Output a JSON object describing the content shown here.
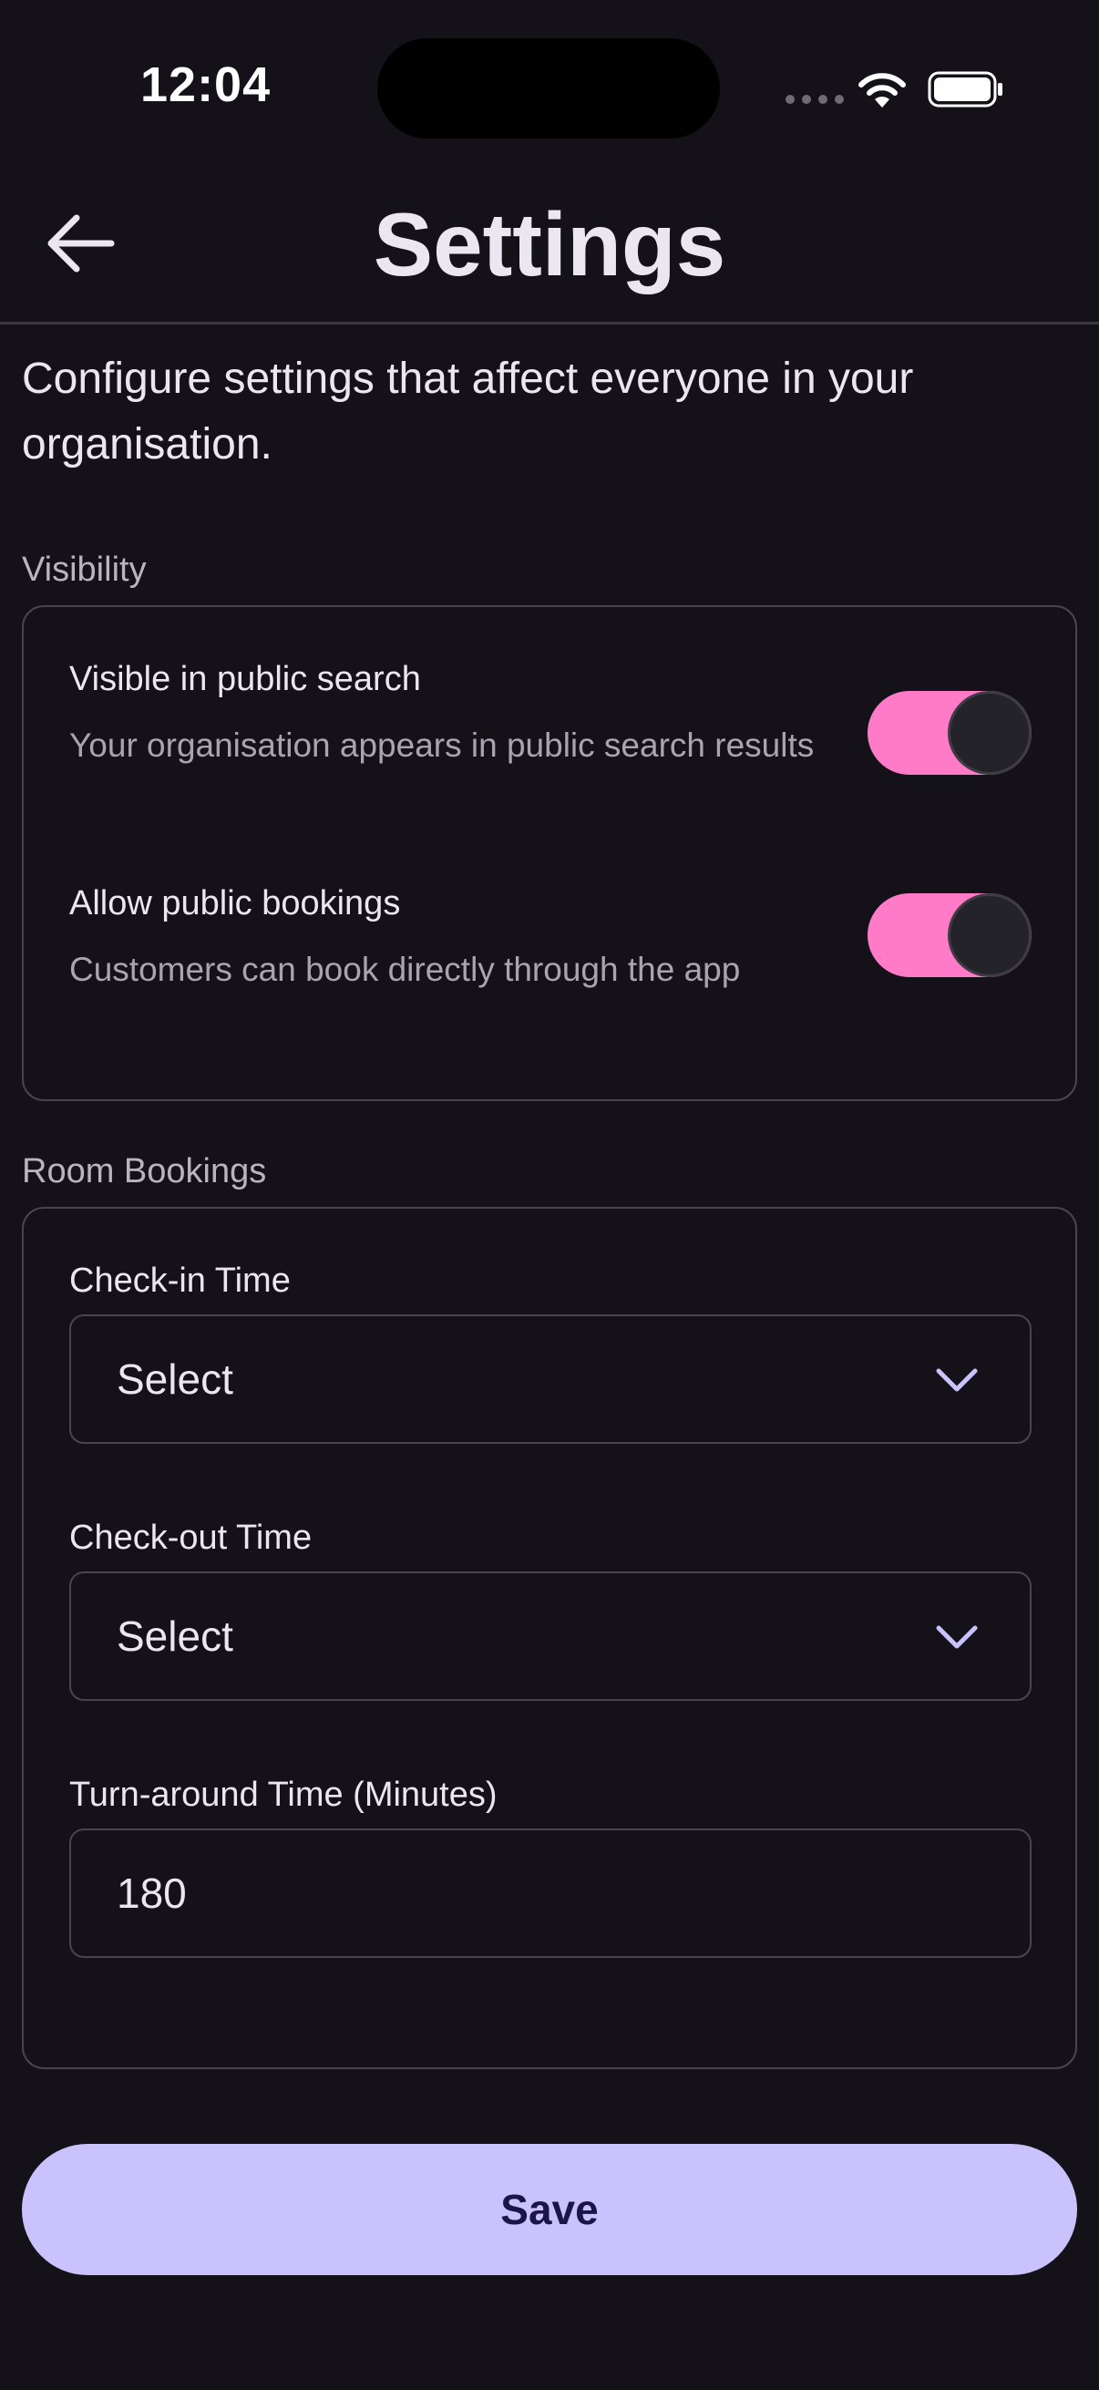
{
  "status_bar": {
    "time": "12:04"
  },
  "header": {
    "title": "Settings"
  },
  "intro": "Configure settings that affect everyone in your organisation.",
  "visibility": {
    "section_label": "Visibility",
    "items": [
      {
        "title": "Visible in public search",
        "description": "Your organisation appears in public search results",
        "enabled": true
      },
      {
        "title": "Allow public bookings",
        "description": "Customers can book directly through the app",
        "enabled": true
      }
    ]
  },
  "room_bookings": {
    "section_label": "Room Bookings",
    "check_in": {
      "label": "Check-in Time",
      "value": "Select"
    },
    "check_out": {
      "label": "Check-out Time",
      "value": "Select"
    },
    "turnaround": {
      "label": "Turn-around Time (Minutes)",
      "value": "180"
    }
  },
  "save_label": "Save",
  "colors": {
    "background": "#141218",
    "toggle_on": "#FF7BC8",
    "primary_button": "#C9C2FC",
    "primary_button_text": "#1D1449",
    "chevron": "#C9C2FC"
  },
  "icons": {
    "back": "arrow-left-icon",
    "wifi": "wifi-icon",
    "battery": "battery-icon",
    "dropdown": "chevron-down-icon"
  }
}
